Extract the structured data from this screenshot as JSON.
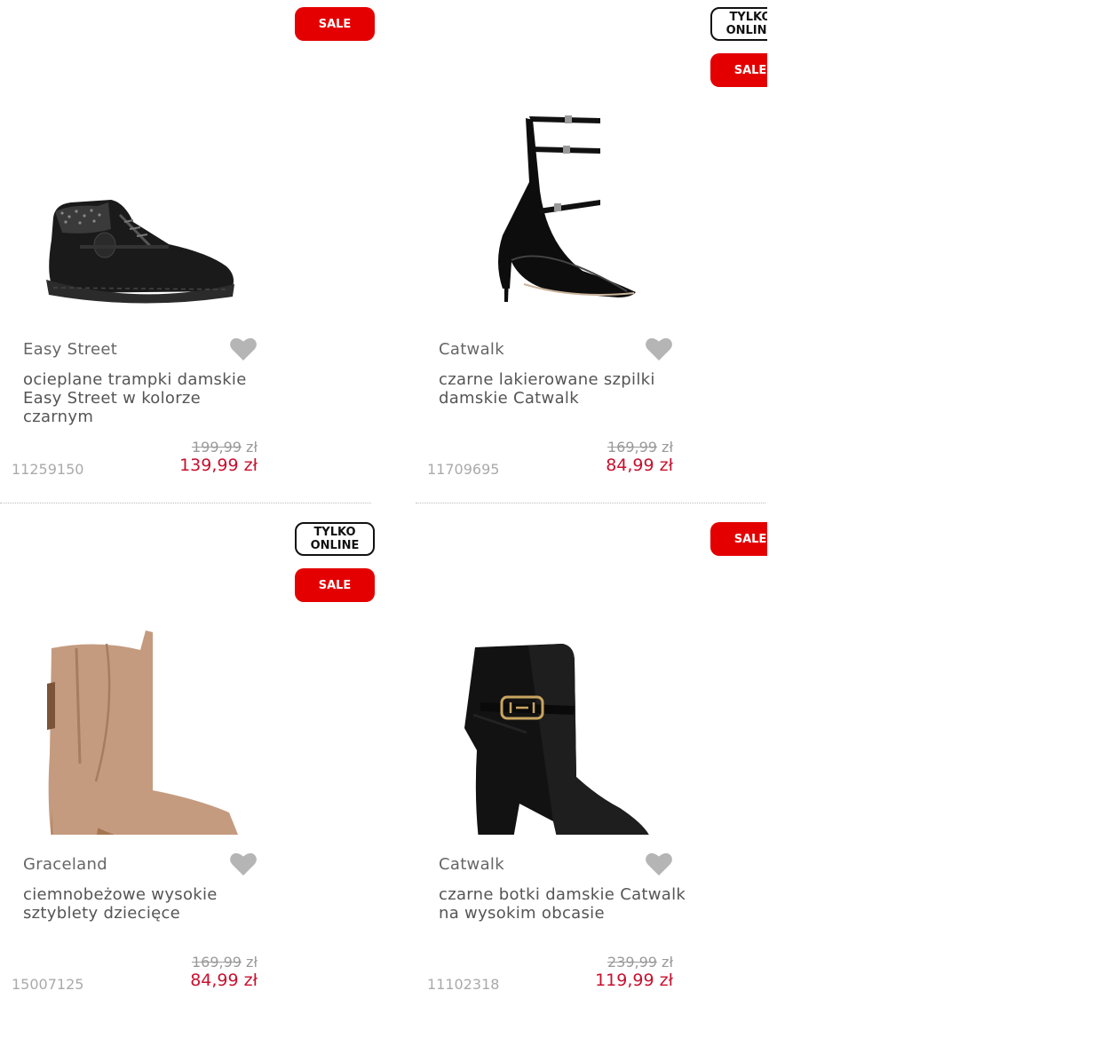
{
  "badges": {
    "sale": "SALE",
    "online": "TYLKO\nONLINE"
  },
  "products": [
    {
      "brand": "Easy Street",
      "title": "ocieplane trampki damskie Easy Street w kolorze czarnym",
      "old_price": "199,99",
      "old_currency": "zł",
      "price": "139,99 zł",
      "sku": "11259150",
      "badges": [
        "sale"
      ],
      "image": "black-ankle-sneaker"
    },
    {
      "brand": "Catwalk",
      "title": "czarne lakierowane szpilki damskie Catwalk",
      "old_price": "169,99",
      "old_currency": "zł",
      "price": "84,99 zł",
      "sku": "11709695",
      "badges": [
        "online",
        "sale"
      ],
      "image": "black-strappy-pump"
    },
    {
      "brand": "Graceland",
      "title": "ciemnobeżowe wysokie sztyblety dziecięce",
      "old_price": "169,99",
      "old_currency": "zł",
      "price": "84,99 zł",
      "sku": "15007125",
      "badges": [
        "online",
        "sale"
      ],
      "image": "beige-chelsea-boot"
    },
    {
      "brand": "Catwalk",
      "title": "czarne botki damskie Catwalk na wysokim obcasie",
      "old_price": "239,99",
      "old_currency": "zł",
      "price": "119,99 zł",
      "sku": "11102318",
      "badges": [
        "sale"
      ],
      "image": "black-heeled-bootie"
    }
  ],
  "colors": {
    "sale": "#e40000",
    "price": "#c8102e",
    "heart": "#b5b5b5"
  }
}
